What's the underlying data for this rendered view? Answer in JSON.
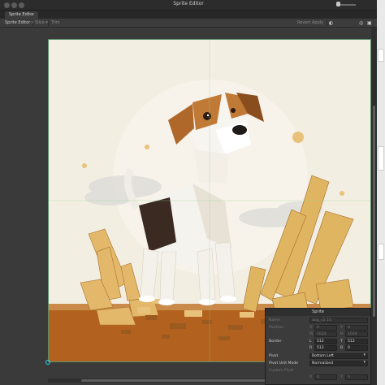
{
  "window": {
    "title": "Sprite Editor",
    "tab_label": "Sprite Editor"
  },
  "toolbar": {
    "mode_dropdown": "Sprite Editor",
    "slice_label": "Slice",
    "trim_label": "Trim",
    "revert_label": "Revert",
    "apply_label": "Apply"
  },
  "sprite_panel": {
    "header": "Sprite",
    "name_label": "Name",
    "name_value": "dog_v1 10",
    "position_label": "Position",
    "x_label": "X",
    "x_value": "0",
    "y_label": "Y",
    "y_value": "0",
    "w_label": "W",
    "w_value": "1024",
    "h_label": "H",
    "h_value": "1024",
    "border_label": "Border",
    "l_label": "L",
    "l_value": "512",
    "t_label": "T",
    "t_value": "512",
    "r_label": "R",
    "r_value": "512",
    "b_label": "B",
    "b_value": "0",
    "pivot_label": "Pivot",
    "pivot_value": "Bottom Left",
    "pivot_unit_label": "Pivot Unit Mode",
    "pivot_unit_value": "Normalized",
    "custom_pivot_label": "Custom Pivot",
    "cx_label": "X",
    "cx_value": "0",
    "cy_label": "Y",
    "cy_value": "0"
  },
  "colors": {
    "window_bg": "#383838",
    "canvas_bg": "#3a3a3a",
    "sprite_bg": "#f3eee2",
    "accent_green": "#5a8f6a",
    "pivot_cyan": "#2ad0ff"
  }
}
